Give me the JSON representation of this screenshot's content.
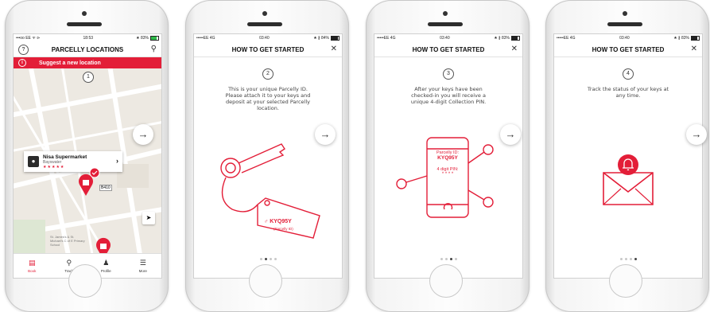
{
  "colors": {
    "brand_red": "#e31e38",
    "map_bg": "#ede9e2"
  },
  "screen1": {
    "status": {
      "left": "•••oo EE ᯤ ⊳",
      "time": "18:53",
      "right": "★ 83%"
    },
    "title": "PARCELLY LOCATIONS",
    "banner": "Suggest a new location",
    "step": "1",
    "location": {
      "name": "Nisa Supermarket",
      "area": "Bayswater",
      "rating": "★★★★★"
    },
    "road_label": "B410",
    "map_label": "St. James's & St. Michael's C of E Primary School",
    "tabs": [
      {
        "label": "Book",
        "icon": "book-icon"
      },
      {
        "label": "Track",
        "icon": "pin-icon"
      },
      {
        "label": "Profile",
        "icon": "profile-icon"
      },
      {
        "label": "More",
        "icon": "menu-icon"
      }
    ]
  },
  "screen2": {
    "status": {
      "left": "•••••EE 4G",
      "time": "03:40",
      "right": "★ ∦ 84%"
    },
    "title": "HOW TO GET STARTED",
    "step": "2",
    "text": "This is your unique Parcelly ID. Please attach it to your keys and deposit at your selected Parcelly location.",
    "tag_id": "KYQ95Y",
    "tag_sub": "(Parcelly ID)"
  },
  "screen3": {
    "status": {
      "left": "•••••EE 4G",
      "time": "03:40",
      "right": "★ ∦ 83%"
    },
    "title": "HOW TO GET STARTED",
    "step": "3",
    "text": "After your keys have been checked-in you will receive a unique 4-digit Collection PIN.",
    "phone_label": "Parcelly ID:",
    "phone_id": "KYQ95Y",
    "pin_label": "4 digit PIN:",
    "pin_value": "* * * *"
  },
  "screen4": {
    "status": {
      "left": "•••••EE 4G",
      "time": "03:40",
      "right": "★ ∦ 83%"
    },
    "title": "HOW TO GET STARTED",
    "step": "4",
    "text": "Track the status of your keys at any time."
  },
  "close_glyph": "✕",
  "next_glyph": "→"
}
